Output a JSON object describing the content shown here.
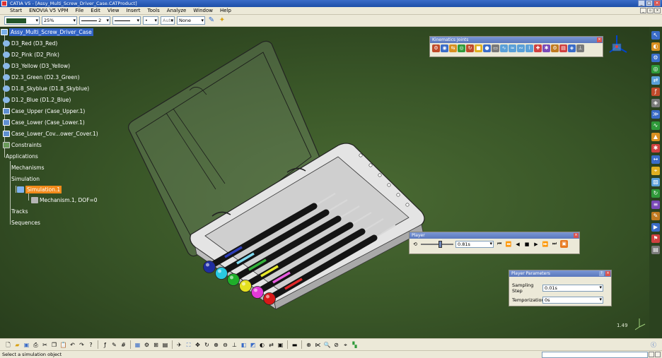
{
  "window": {
    "title": "CATIA V5 - [Assy_Multi_Screw_Driver_Case.CATProduct]"
  },
  "menu": [
    "Start",
    "ENOVIA V5 VPM",
    "File",
    "Edit",
    "View",
    "Insert",
    "Tools",
    "Analyze",
    "Window",
    "Help"
  ],
  "props_toolbar": {
    "transparency": "25%",
    "line_weight": "2",
    "point_style": "•",
    "layer_auto": "Auto",
    "layer_value": "None"
  },
  "tree": {
    "root": "Assy_Multi_Screw_Driver_Case",
    "parts": [
      "D3_Red (D3_Red)",
      "D2_Pink (D2_Pink)",
      "D3_Yellow (D3_Yellow)",
      "D2.3_Green (D2.3_Green)",
      "D1.8_Skyblue (D1.8_Skyblue)",
      "D1.2_Blue (D1.2_Blue)",
      "Case_Upper (Case_Upper.1)",
      "Case_Lower (Case_Lower.1)",
      "Case_Lower_Cov...ower_Cover.1)"
    ],
    "constraints": "Constraints",
    "applications": "Applications",
    "mechanisms": "Mechanisms",
    "simulation": "Simulation",
    "simulation_1": "Simulation.1",
    "mechanism_1": "Mechanism.1, DOF=0",
    "tracks": "Tracks",
    "sequences": "Sequences"
  },
  "kinematics_toolbar": {
    "title": "Kinematics Joints"
  },
  "player": {
    "title": "Player",
    "time": "0.81s",
    "progress": 0.6
  },
  "player_params": {
    "title": "Player Parameters",
    "sampling_label": "Sampling Step",
    "sampling_value": "0.01s",
    "temporization_label": "Temporization",
    "temporization_value": "0s"
  },
  "viewport": {
    "scale": "1.49"
  },
  "status": {
    "message": "Select a simulation object"
  },
  "drivers": [
    {
      "color": "#2c3db8",
      "tip": "#1f2ea0"
    },
    {
      "color": "#7fd9f0",
      "tip": "#29c9e0"
    },
    {
      "color": "#33b13a",
      "tip": "#1fae2a"
    },
    {
      "color": "#e8e82a",
      "tip": "#e4e020"
    },
    {
      "color": "#e85be0",
      "tip": "#e33ad8"
    },
    {
      "color": "#e02828",
      "tip": "#d81818"
    }
  ]
}
